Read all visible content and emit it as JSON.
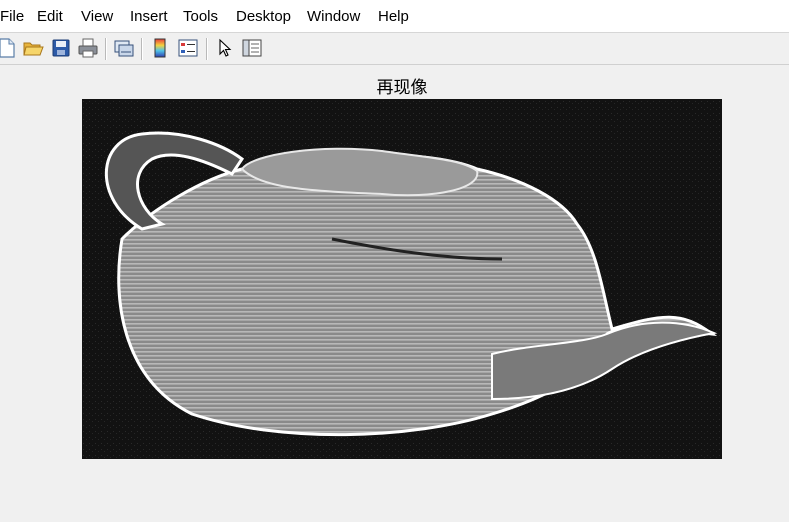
{
  "menu": {
    "items": [
      "File",
      "Edit",
      "View",
      "Insert",
      "Tools",
      "Desktop",
      "Window",
      "Help"
    ]
  },
  "toolbar": {
    "buttons": [
      {
        "name": "new-figure-icon"
      },
      {
        "name": "open-file-icon"
      },
      {
        "name": "save-figure-icon"
      },
      {
        "name": "print-figure-icon"
      },
      {
        "name": "link-plot-icon"
      },
      {
        "name": "insert-colorbar-icon"
      },
      {
        "name": "insert-legend-icon"
      },
      {
        "name": "edit-plot-icon"
      },
      {
        "name": "plot-tools-icon"
      }
    ]
  },
  "figure": {
    "title": "再现像"
  },
  "colors": {
    "menu_bg": "#ffffff",
    "window_bg": "#f0f0f0",
    "image_bg": "#0e0e0e"
  }
}
